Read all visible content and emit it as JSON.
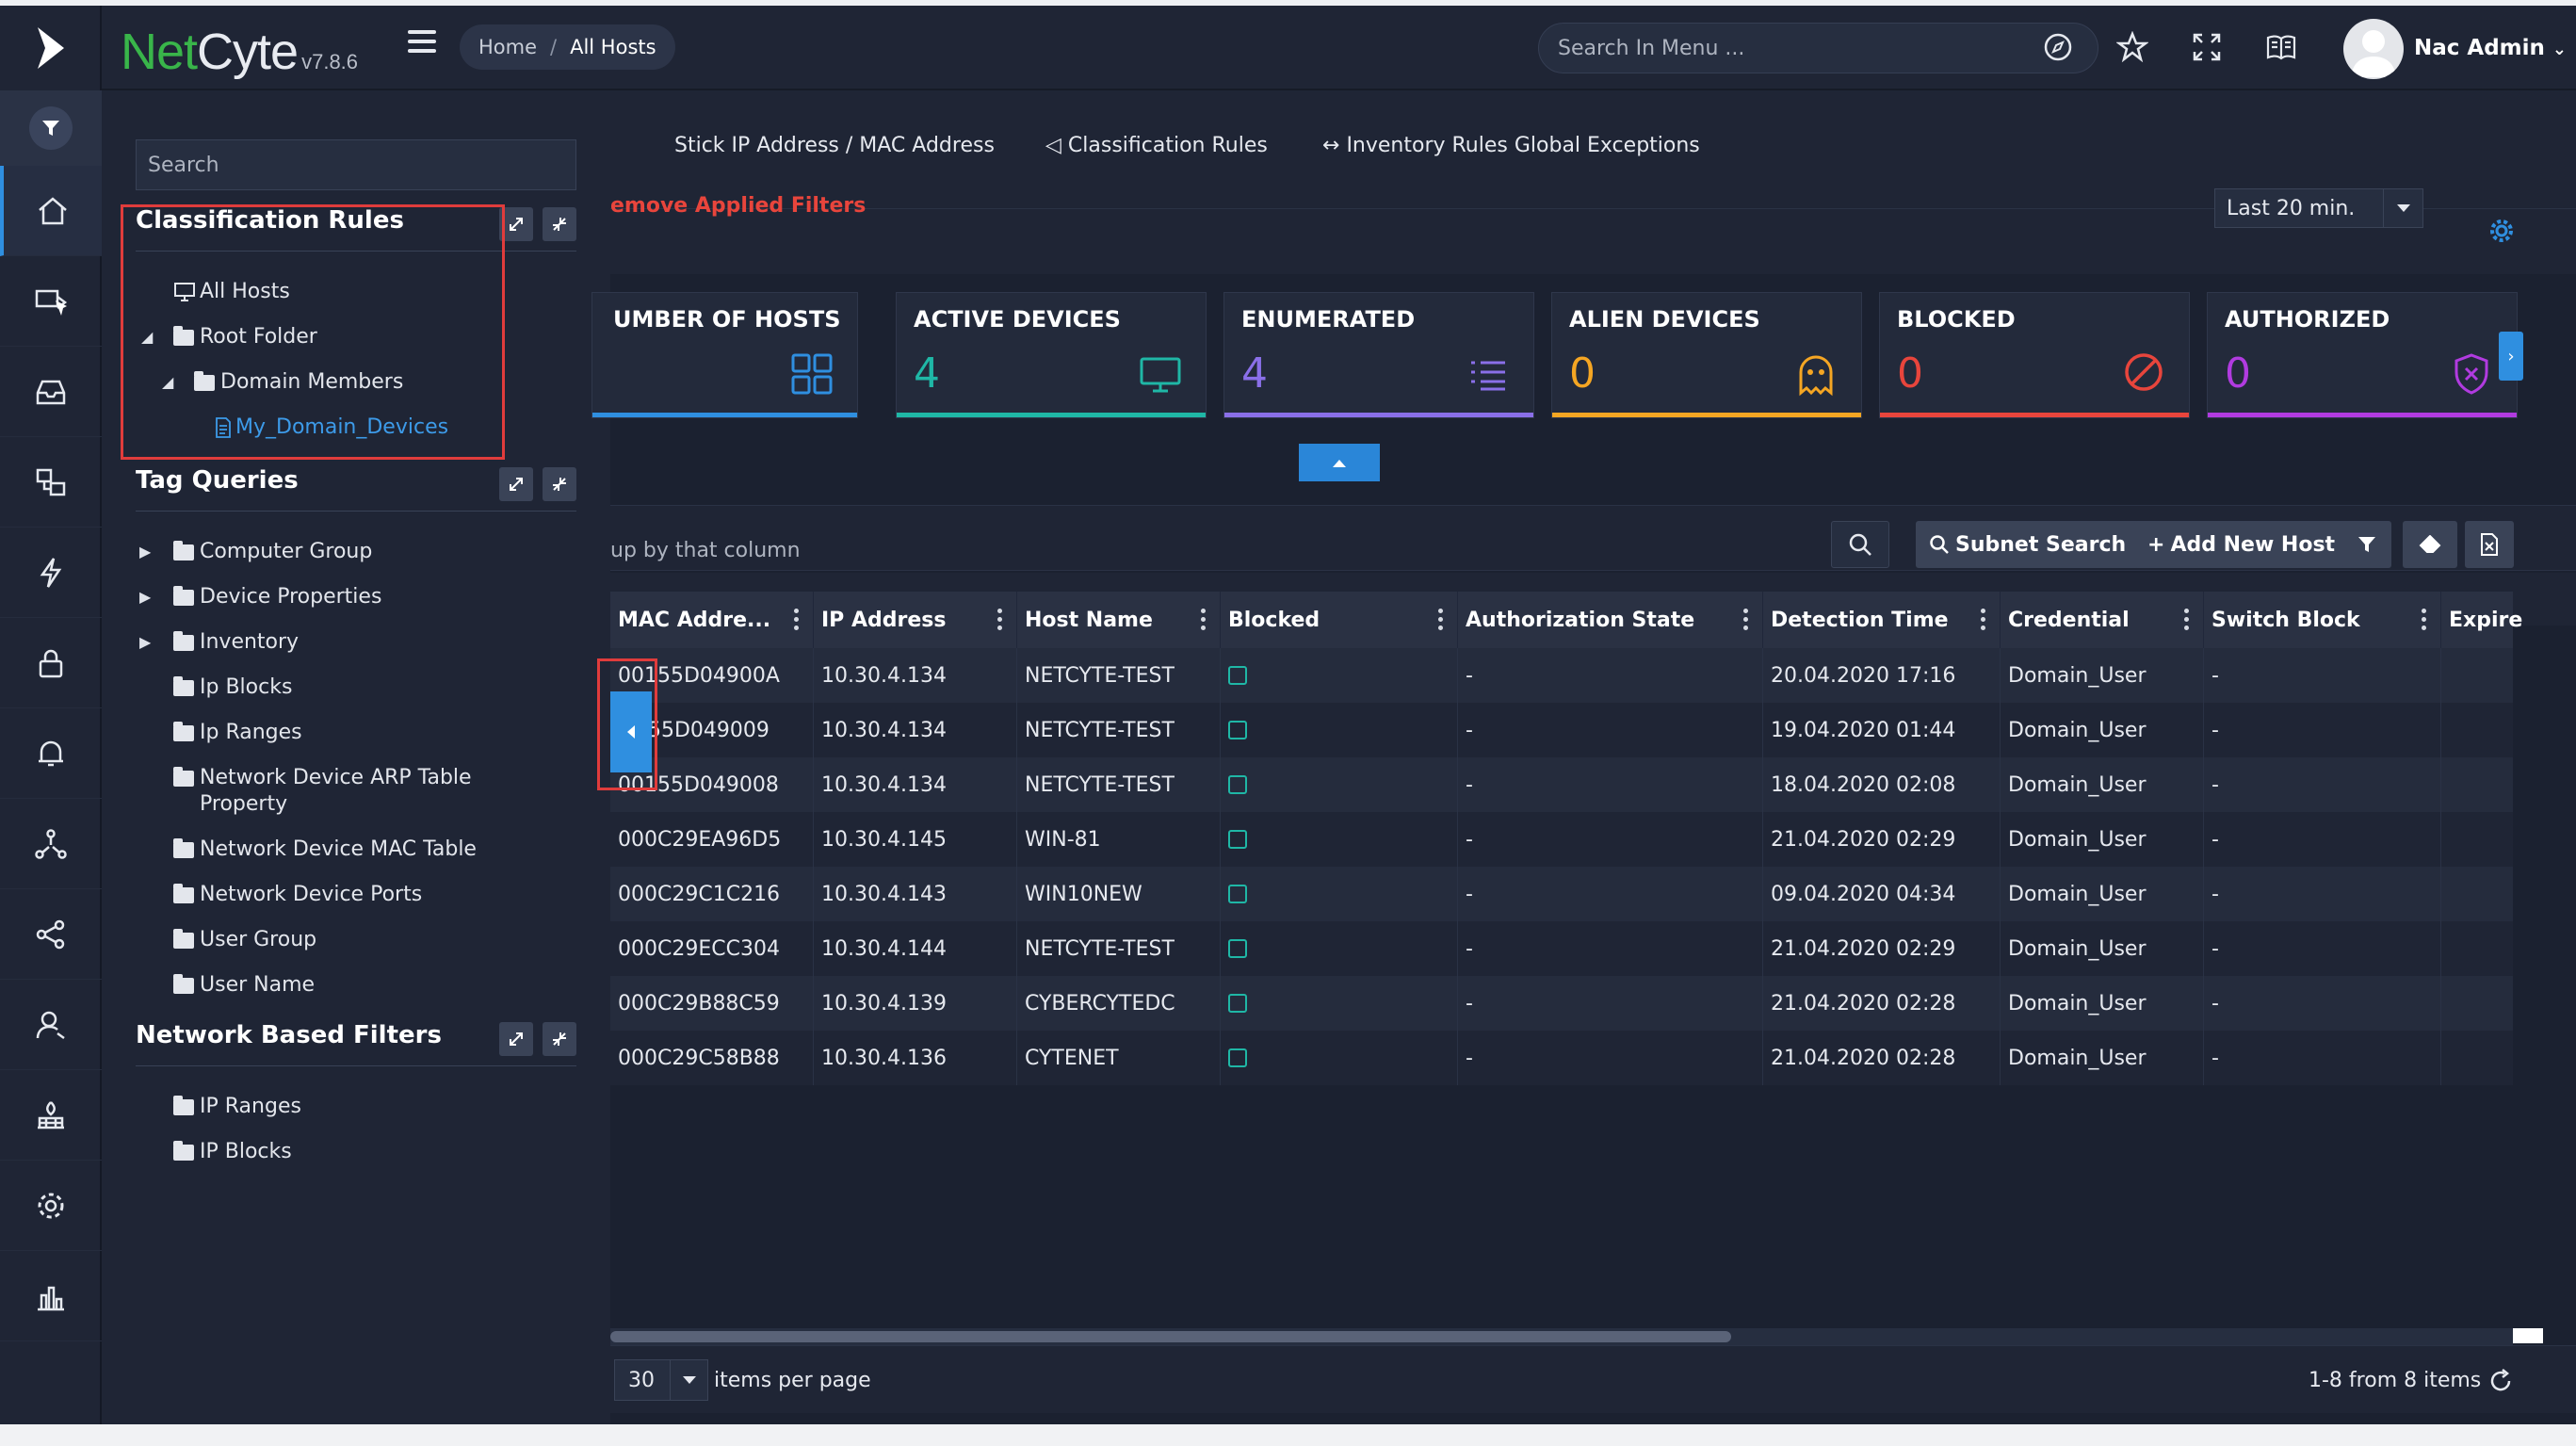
{
  "app": {
    "brand_net": "Net",
    "brand_cyte": "Cyte",
    "version": "v7.8.6"
  },
  "breadcrumb": {
    "home": "Home",
    "separator": "/",
    "current": "All Hosts"
  },
  "header": {
    "menu_search_placeholder": "Search In Menu ...",
    "user_name": "Nac Admin"
  },
  "tree": {
    "search_placeholder": "Search",
    "classification": {
      "title": "Classification Rules",
      "items": [
        "All Hosts",
        "Root Folder",
        "Domain Members",
        "My_Domain_Devices"
      ]
    },
    "tag_queries": {
      "title": "Tag Queries",
      "items": [
        "Computer Group",
        "Device Properties",
        "Inventory",
        "Ip Blocks",
        "Ip Ranges",
        "Network Device ARP Table Property",
        "Network Device MAC Table",
        "Network Device Ports",
        "User Group",
        "User Name"
      ]
    },
    "network_filters": {
      "title": "Network Based Filters",
      "items": [
        "IP Ranges",
        "IP Blocks"
      ]
    }
  },
  "tabs": [
    "Stick IP Address / MAC Address",
    "Classification Rules",
    "Inventory Rules Global Exceptions"
  ],
  "filter": {
    "remove_label": "emove Applied Filters",
    "time_range": "Last 20 min."
  },
  "cards": [
    {
      "title": "UMBER OF HOSTS",
      "value": "",
      "color": "#2f8fe0"
    },
    {
      "title": "ACTIVE DEVICES",
      "value": "4",
      "color": "#1fb7a6"
    },
    {
      "title": "ENUMERATED",
      "value": "4",
      "color": "#8a6fe8"
    },
    {
      "title": "ALIEN DEVICES",
      "value": "0",
      "color": "#f5a623"
    },
    {
      "title": "BLOCKED",
      "value": "0",
      "color": "#e8453c"
    },
    {
      "title": "AUTHORIZED",
      "value": "0",
      "color": "#b13be0"
    }
  ],
  "toolbar": {
    "subnet_search": "Subnet Search",
    "add_host": "Add New Host"
  },
  "grid": {
    "group_hint": "up by that column",
    "columns": [
      "MAC Addre...",
      "IP Address",
      "Host Name",
      "Blocked",
      "Authorization State",
      "Detection Time",
      "Credential",
      "Switch Block",
      "Expire"
    ],
    "rows": [
      {
        "mac": "00155D04900A",
        "ip": "10.30.4.134",
        "host": "NETCYTE-TEST",
        "auth": "-",
        "time": "20.04.2020 17:16",
        "cred": "Domain_User",
        "switch": "-"
      },
      {
        "mac": "55D049009",
        "ip": "10.30.4.134",
        "host": "NETCYTE-TEST",
        "auth": "-",
        "time": "19.04.2020 01:44",
        "cred": "Domain_User",
        "switch": "-"
      },
      {
        "mac": "00155D049008",
        "ip": "10.30.4.134",
        "host": "NETCYTE-TEST",
        "auth": "-",
        "time": "18.04.2020 02:08",
        "cred": "Domain_User",
        "switch": "-"
      },
      {
        "mac": "000C29EA96D5",
        "ip": "10.30.4.145",
        "host": "WIN-81",
        "auth": "-",
        "time": "21.04.2020 02:29",
        "cred": "Domain_User",
        "switch": "-"
      },
      {
        "mac": "000C29C1C216",
        "ip": "10.30.4.143",
        "host": "WIN10NEW",
        "auth": "-",
        "time": "09.04.2020 04:34",
        "cred": "Domain_User",
        "switch": "-"
      },
      {
        "mac": "000C29ECC304",
        "ip": "10.30.4.144",
        "host": "NETCYTE-TEST",
        "auth": "-",
        "time": "21.04.2020 02:29",
        "cred": "Domain_User",
        "switch": "-"
      },
      {
        "mac": "000C29B88C59",
        "ip": "10.30.4.139",
        "host": "CYBERCYTEDC",
        "auth": "-",
        "time": "21.04.2020 02:28",
        "cred": "Domain_User",
        "switch": "-"
      },
      {
        "mac": "000C29C58B88",
        "ip": "10.30.4.136",
        "host": "CYTENET",
        "auth": "-",
        "time": "21.04.2020 02:28",
        "cred": "Domain_User",
        "switch": "-"
      }
    ]
  },
  "pager": {
    "page_size": "30",
    "label": "items per page",
    "info": "1-8 from 8 items"
  }
}
